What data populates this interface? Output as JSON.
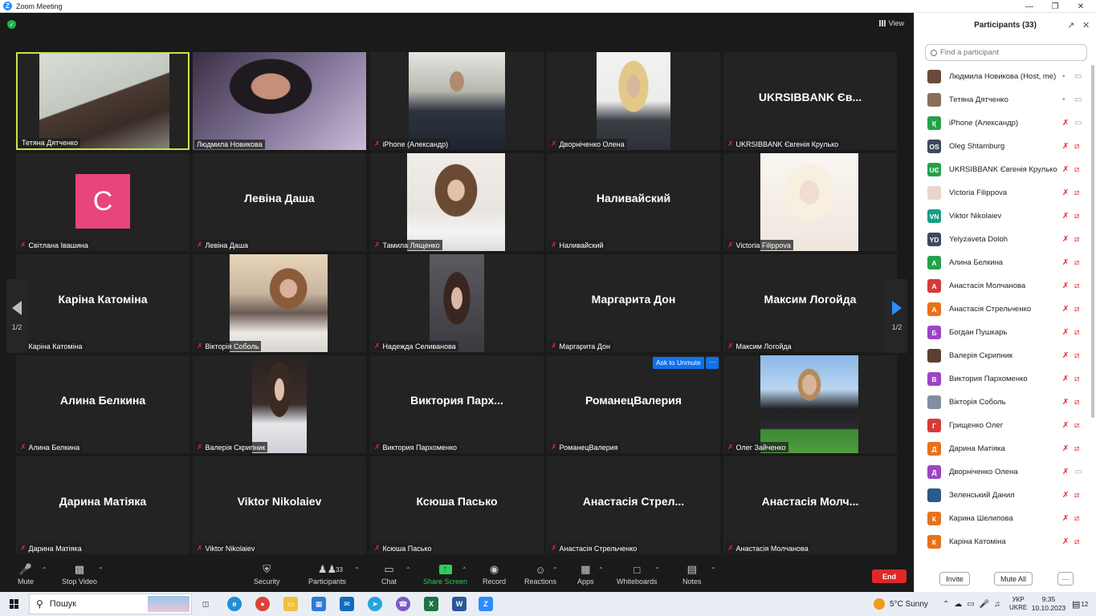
{
  "window": {
    "title": "Zoom Meeting"
  },
  "meeting": {
    "view_label": "View",
    "page_indicator": "1/2",
    "ask_to_unmute_label": "Ask to Unmute",
    "more_label": "···",
    "tiles": [
      {
        "name": "Тетяна Дятченко",
        "big": "",
        "muted": false,
        "active": true,
        "video": "woman-dark-hair"
      },
      {
        "name": "Людмила Новикова",
        "big": "",
        "muted": false,
        "video": "woman-short-hair"
      },
      {
        "name": "iPhone (Александр)",
        "big": "",
        "muted": true,
        "video": "man-car"
      },
      {
        "name": "Дворніченко Олена",
        "big": "",
        "muted": true,
        "video": "woman-blonde"
      },
      {
        "name": "UKRSIBBANK Євгенія Крулько",
        "big": "UKRSIBBANK Єв...",
        "muted": true
      },
      {
        "name": "Світлана Івашина",
        "big": "",
        "muted": true,
        "avatar": "C"
      },
      {
        "name": "Левіна Даша",
        "big": "Левіна Даша",
        "muted": true
      },
      {
        "name": "Тамила Лященко",
        "big": "",
        "muted": true,
        "video": "girl-white-shirt"
      },
      {
        "name": "Наливайский",
        "big": "Наливайский",
        "muted": true
      },
      {
        "name": "Victoria Filippova",
        "big": "",
        "muted": true,
        "video": "illustration-blonde"
      },
      {
        "name": "Каріна Катоміна",
        "big": "Каріна Катоміна",
        "muted": true
      },
      {
        "name": "Вікторія Соболь",
        "big": "",
        "muted": true,
        "video": "girl-city"
      },
      {
        "name": "Надежда Селиванова",
        "big": "",
        "muted": true,
        "video": "girl-car"
      },
      {
        "name": "Маргарита Дон",
        "big": "Маргарита Дон",
        "muted": true
      },
      {
        "name": "Максим Логойда",
        "big": "Максим Логойда",
        "muted": true
      },
      {
        "name": "Алина Белкина",
        "big": "Алина Белкина",
        "muted": true
      },
      {
        "name": "Валерія Скрипник",
        "big": "",
        "muted": true,
        "video": "girl-hoodie"
      },
      {
        "name": "Виктория Пархоменко",
        "big": "Виктория Парх...",
        "muted": true
      },
      {
        "name": "РоманецВалерия",
        "big": "РоманецВалерия",
        "muted": true
      },
      {
        "name": "Олег Зайченко",
        "big": "",
        "muted": true,
        "video": "boy-field"
      },
      {
        "name": "Дарина Матіяка",
        "big": "Дарина Матіяка",
        "muted": true
      },
      {
        "name": "Viktor Nikolaiev",
        "big": "Viktor Nikolaiev",
        "muted": true
      },
      {
        "name": "Ксюша Пасько",
        "big": "Ксюша Пасько",
        "muted": true
      },
      {
        "name": "Анастасія Стрельченко",
        "big": "Анастасія Стрел...",
        "muted": true
      },
      {
        "name": "Анастасія Молчанова",
        "big": "Анастасія Молч...",
        "muted": true
      }
    ]
  },
  "toolbar": {
    "mute": "Mute",
    "stop_video": "Stop Video",
    "security": "Security",
    "participants": "Participants",
    "participants_count": "33",
    "chat": "Chat",
    "share_screen": "Share Screen",
    "record": "Record",
    "reactions": "Reactions",
    "apps": "Apps",
    "whiteboards": "Whiteboards",
    "notes": "Notes",
    "end": "End"
  },
  "panel": {
    "title": "Participants (33)",
    "search_placeholder": "Find a participant",
    "invite": "Invite",
    "mute_all": "Mute All",
    "more": "···",
    "participants": [
      {
        "name": "Людмила Новикова (Host, me)",
        "initials": "",
        "color": "#6b4a3a",
        "mic": "on",
        "cam": "on"
      },
      {
        "name": "Тетяна Дятченко",
        "initials": "",
        "color": "#8a6d5a",
        "mic": "on",
        "cam": "on"
      },
      {
        "name": "iPhone (Александр)",
        "initials": "I(",
        "color": "#24a148",
        "mic": "off",
        "cam": "on"
      },
      {
        "name": "Oleg Shtamburg",
        "initials": "OS",
        "color": "#3d4a5c",
        "mic": "off",
        "cam": "off"
      },
      {
        "name": "UKRSIBBANK Євгенія Крулько",
        "initials": "UЄ",
        "color": "#24a148",
        "mic": "off",
        "cam": "off"
      },
      {
        "name": "Victoria Filippova",
        "initials": "",
        "color": "#e8d5cc",
        "mic": "off",
        "cam": "off"
      },
      {
        "name": "Viktor Nikolaiev",
        "initials": "VN",
        "color": "#16a085",
        "mic": "off",
        "cam": "off"
      },
      {
        "name": "Yelyzaveta Doloh",
        "initials": "YD",
        "color": "#3d4a5c",
        "mic": "off",
        "cam": "off"
      },
      {
        "name": "Алина Белкина",
        "initials": "А",
        "color": "#24a148",
        "mic": "off",
        "cam": "off"
      },
      {
        "name": "Анастасія Молчанова",
        "initials": "А",
        "color": "#d63a3a",
        "mic": "off",
        "cam": "off"
      },
      {
        "name": "Анастасія Стрельченко",
        "initials": "А",
        "color": "#e8711a",
        "mic": "off",
        "cam": "off"
      },
      {
        "name": "Богдан Пушкарь",
        "initials": "Б",
        "color": "#9b45c4",
        "mic": "off",
        "cam": "off"
      },
      {
        "name": "Валерія Скрипник",
        "initials": "",
        "color": "#5a4030",
        "mic": "off",
        "cam": "off"
      },
      {
        "name": "Виктория Пархоменко",
        "initials": "В",
        "color": "#9b45c4",
        "mic": "off",
        "cam": "off"
      },
      {
        "name": "Вікторія Соболь",
        "initials": "",
        "color": "#8090a0",
        "mic": "off",
        "cam": "off"
      },
      {
        "name": "Грищенко Олег",
        "initials": "Г",
        "color": "#d63a3a",
        "mic": "off",
        "cam": "off"
      },
      {
        "name": "Дарина Матіяка",
        "initials": "Д",
        "color": "#e8711a",
        "mic": "off",
        "cam": "off"
      },
      {
        "name": "Дворніченко Олена",
        "initials": "Д",
        "color": "#9b45c4",
        "mic": "off",
        "cam": "on"
      },
      {
        "name": "Зеленський Данил",
        "initials": "",
        "color": "#2a5a8a",
        "mic": "off",
        "cam": "off"
      },
      {
        "name": "Карина Шелипова",
        "initials": "К",
        "color": "#e8711a",
        "mic": "off",
        "cam": "off"
      },
      {
        "name": "Каріна Катоміна",
        "initials": "К",
        "color": "#e8711a",
        "mic": "off",
        "cam": "off"
      }
    ]
  },
  "taskbar": {
    "search_placeholder": "Пошук",
    "weather": "5°C  Sunny",
    "lang_top": "УКР",
    "lang_bottom": "UKRE",
    "time": "9:35",
    "date": "10.10.2023",
    "notif_count": "12"
  }
}
